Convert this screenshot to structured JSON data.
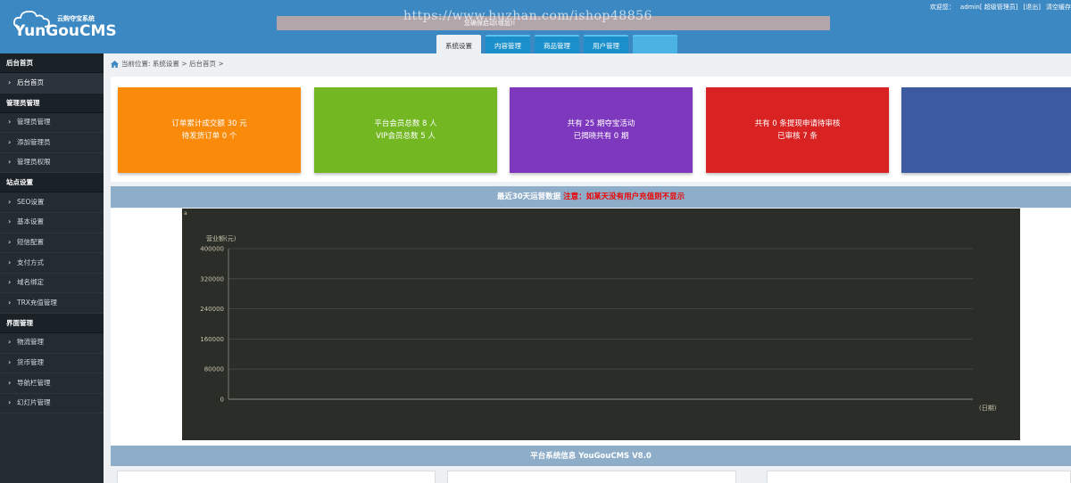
{
  "header": {
    "logo_cn": "云购夺宝系统",
    "logo_en": "YunGouCMS",
    "notice": "您确保启动(增加)!",
    "watermark": "https://www.huzhan.com/ishop48856",
    "top_links": [
      "欢迎您：",
      "admin[ 超级管理员]",
      "[退出]",
      "清空缓存"
    ],
    "tabs": [
      {
        "label": "系统设置",
        "active": true
      },
      {
        "label": "内容管理",
        "active": false
      },
      {
        "label": "商品管理",
        "active": false
      },
      {
        "label": "用户管理",
        "active": false
      },
      {
        "label": "",
        "active": false
      }
    ]
  },
  "sidebar": {
    "groups": [
      {
        "title": "后台首页",
        "items": [
          "后台首页"
        ]
      },
      {
        "title": "管理员管理",
        "items": [
          "管理员管理",
          "添加管理员",
          "管理员权限"
        ]
      },
      {
        "title": "站点设置",
        "items": [
          "SEO设置",
          "基本设置",
          "短信配置",
          "支付方式",
          "域名绑定",
          "TRX充值管理"
        ]
      },
      {
        "title": "界面管理",
        "items": [
          "物流管理",
          "货币管理",
          "导航栏管理",
          "幻灯片管理"
        ]
      }
    ]
  },
  "breadcrumb": "当前位置: 系统设置 >  后台首页 >",
  "cards": [
    {
      "line1": "订单累计成交额 30 元",
      "line2": "待发货订单 0 个",
      "color": "#f98a0a"
    },
    {
      "line1": "平台会员总数 8 人",
      "line2": "VIP会员总数 5 人",
      "color": "#73b823"
    },
    {
      "line1": "共有 25 期夺宝活动",
      "line2": "已揭晓共有 0 期",
      "color": "#7e38be"
    },
    {
      "line1": "共有 0 条提现申请待审核",
      "line2": "已审核 7 条",
      "color": "#d92323"
    },
    {
      "line1": "",
      "line2": "",
      "color": "#3b5aa0"
    }
  ],
  "chart_section": {
    "title": "最近30天运营数据",
    "warning": "注意：如某天没有用户充值则不显示"
  },
  "chart_data": {
    "type": "line",
    "ylabel": "营业额(元)",
    "xlabel": "(日期)",
    "ylim": [
      0,
      400000
    ],
    "yticks": [
      "400000",
      "320000",
      "240000",
      "160000",
      "80000",
      "0"
    ],
    "series": []
  },
  "info_section": {
    "title": "平台系统信息 YouGouCMS V8.0"
  }
}
